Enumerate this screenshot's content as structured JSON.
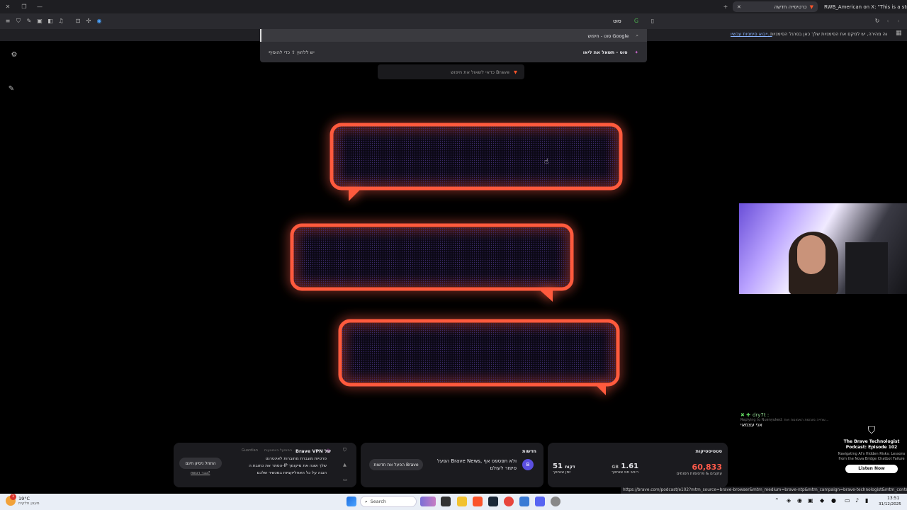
{
  "tabs": [
    {
      "title": "כרטיסייה חדשה",
      "active": true
    },
    {
      "title": "RWB_American on X: \"This is a strang",
      "active": false
    }
  ],
  "omnibox": {
    "query": "סוט",
    "suggestions": [
      {
        "text": "סוט - חיפוש Google",
        "icon": "search-icon"
      },
      {
        "text": "סוט - תשאל את ליאו",
        "hint": "יש ללחוץ ⇧ כדי להוסיף",
        "icon": "leo-icon"
      }
    ],
    "brave_hint": "כדאי לשאול את חיפוש Brave"
  },
  "infobar": {
    "text": "לגישה מהירה, יש למקם את הסימניות שלך כאן בסרגל הסימניות.",
    "link": "ייבוא סימניות עכשיו..."
  },
  "webcam": {
    "label": "webcam feed"
  },
  "chat": {
    "user": "dry7t :",
    "reply_context": "Replying to Nuenyuked: שהייה מוגזמת האמונות ואת...",
    "message": "אני עצמאי"
  },
  "podcast": {
    "title": "The Brave Technologist Podcast: Episode 102",
    "subtitle": "Navigating AI's Hidden Risks: Lessons from the Nova Bridge Chatbot Failure",
    "button": "Listen Now"
  },
  "cards": {
    "vpn": {
      "title": "Brave VPN של",
      "badge": "Guardian",
      "subtitle": "המופעל באמצעות",
      "features": [
        "פרטיות מוגברת מחוברות לאינטרנט",
        "הסתר את כתובת ה-IP שלך ושנה את מיקומך",
        "הגנה על כל האפליקציות במכשיר שלכם"
      ],
      "cta": "התחל ניסיון חינם",
      "link": "כבר רכשת?"
    },
    "news": {
      "title": "חדשות",
      "text": "הפעל Brave News, ולא תפספס אף סיפור לעולם",
      "cta": "הפעל את חדשות Brave"
    },
    "stats": {
      "title": "סטטיסטיקות",
      "items": [
        {
          "value": "60,833",
          "label": "עוקבים & פרסומות חסומים"
        },
        {
          "value": "1.61",
          "unit": "GB",
          "label": "רוחב פס שנחסך"
        },
        {
          "value": "51",
          "unit": "דקות",
          "label": "זמן שנחסך"
        }
      ]
    }
  },
  "status_url": "https://brave.com/podcast/e102?mtm_source=brave-browser&mtm_medium=brave-ntp&mtm_campaign=brave-technologist&mtm_content=podcast",
  "taskbar": {
    "weather_temp": "19°C",
    "weather_desc": "מעונן חלקית",
    "search_label": "Search",
    "time": "13:51",
    "date": "31/12/2025"
  },
  "colors": {
    "accent_red": "#ff5a3c",
    "stat_red": "#ff5a4a",
    "brave_orange": "#fb542b"
  }
}
